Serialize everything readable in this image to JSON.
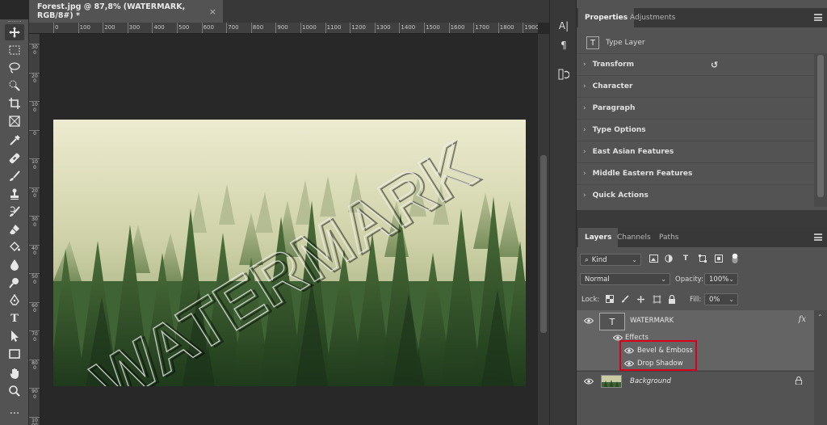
{
  "document": {
    "tab_title": "Forest.jpg @ 87,8% (WATERMARK, RGB/8#) *",
    "close_label": "×",
    "watermark_text": "WATERMARK"
  },
  "ruler": {
    "top_labels": [
      "0",
      "100",
      "200",
      "300",
      "400",
      "500",
      "600",
      "700",
      "800",
      "900",
      "1000",
      "1100",
      "1200",
      "1300",
      "1400",
      "1500",
      "1600",
      "1700",
      "1800",
      "1900"
    ],
    "left_labels": [
      "300",
      "200",
      "100",
      "0",
      "100",
      "200",
      "300",
      "400",
      "500",
      "600",
      "700",
      "800",
      "900",
      "1000"
    ]
  },
  "toolbar": {
    "tools": [
      "move-tool",
      "marquee-tool",
      "lasso-tool",
      "quick-select-tool",
      "crop-tool",
      "frame-tool",
      "eyedropper-tool",
      "healing-tool",
      "brush-tool",
      "clone-stamp-tool",
      "history-brush-tool",
      "eraser-tool",
      "gradient-tool",
      "blur-tool",
      "dodge-tool",
      "pen-tool",
      "type-tool",
      "path-select-tool",
      "rectangle-tool",
      "hand-tool",
      "zoom-tool",
      "more-tools"
    ],
    "more_label": "..."
  },
  "middock": {
    "character_label": "A|",
    "paragraph_label": "¶"
  },
  "properties": {
    "tabs": [
      "Properties",
      "Adjustments"
    ],
    "layer_type": "Type Layer",
    "type_icon_label": "T",
    "sections": [
      "Transform",
      "Character",
      "Paragraph",
      "Type Options",
      "East Asian Features",
      "Middle Eastern Features",
      "Quick Actions"
    ],
    "reset_icon": "↺"
  },
  "layers": {
    "tabs": [
      "Layers",
      "Channels",
      "Paths"
    ],
    "filter_kind": "Kind",
    "blend_mode": "Normal",
    "opacity_label": "Opacity:",
    "opacity_value": "100%",
    "lock_label": "Lock:",
    "fill_label": "Fill:",
    "fill_value": "0%",
    "filter_icon_type": "T",
    "items": {
      "watermark": {
        "name": "WATERMARK",
        "thumb_label": "T",
        "fx_label": "fx"
      },
      "effects_label": "Effects",
      "effects": [
        "Bevel & Emboss",
        "Drop Shadow"
      ],
      "background": {
        "name": "Background"
      }
    }
  },
  "colors": {
    "highlight": "#d9001b",
    "panel": "#535353",
    "canvas_bg": "#282828"
  }
}
